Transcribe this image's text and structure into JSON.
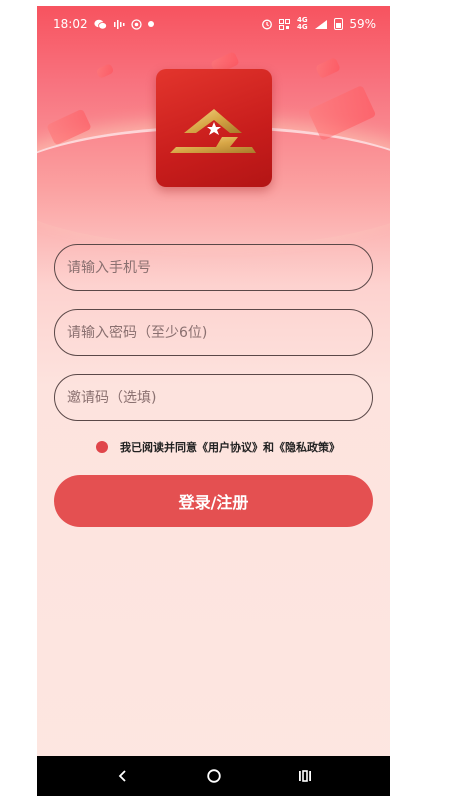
{
  "status_bar": {
    "time": "18:02",
    "battery_percent": "59%",
    "network_top": "4G",
    "network_bottom": "4G"
  },
  "app": {
    "logo_icon": "app-logo-icon",
    "brand_colors": {
      "red": "#e45051",
      "gold": "#d8a747"
    }
  },
  "form": {
    "phone_placeholder": "请输入手机号",
    "password_placeholder": "请输入密码（至少6位)",
    "invite_placeholder": "邀请码（选填)"
  },
  "agreement": {
    "prefix": "我已阅读并同意",
    "user_agreement": "《用户协议》",
    "and": "和",
    "privacy_policy": "《隐私政策》",
    "checked": true
  },
  "login_button": {
    "label": "登录/注册"
  },
  "nav": {
    "back_icon": "back-icon",
    "home_icon": "home-icon",
    "recents_icon": "recents-icon"
  }
}
